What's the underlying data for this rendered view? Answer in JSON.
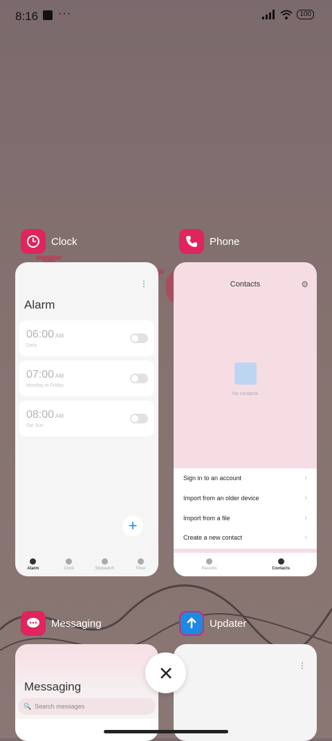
{
  "status": {
    "time": "8:16",
    "battery": "100"
  },
  "apps": {
    "clock": {
      "label": "Clock",
      "screen_title": "Alarm",
      "alarms": [
        {
          "time": "06:00",
          "ampm": "AM",
          "repeat": "Daily"
        },
        {
          "time": "07:00",
          "ampm": "AM",
          "repeat": "Monday to Friday"
        },
        {
          "time": "08:00",
          "ampm": "AM",
          "repeat": "Sat Sun"
        }
      ],
      "tabs": [
        "Alarm",
        "Clock",
        "Stopwatch",
        "Timer"
      ]
    },
    "phone": {
      "label": "Phone",
      "screen_title": "Contacts",
      "empty_text": "No contacts",
      "options": [
        "Sign in to an account",
        "Import from an older device",
        "Import from a file",
        "Create a new contact"
      ],
      "tabs": [
        "Recents",
        "Contacts"
      ]
    },
    "messaging": {
      "label": "Messaging",
      "screen_title": "Messaging",
      "search_placeholder": "Search messages"
    },
    "updater": {
      "label": "Updater"
    }
  },
  "colors": {
    "clock_icon": "#e0245e",
    "phone_icon": "#e0245e",
    "messaging_icon": "#e0245e",
    "updater_icon": "#1e88e5"
  },
  "icons": [
    "alarm-clock-icon",
    "phone-icon",
    "chat-bubble-icon",
    "arrow-up-icon",
    "close-icon",
    "gear-icon",
    "more-vertical-icon"
  ]
}
